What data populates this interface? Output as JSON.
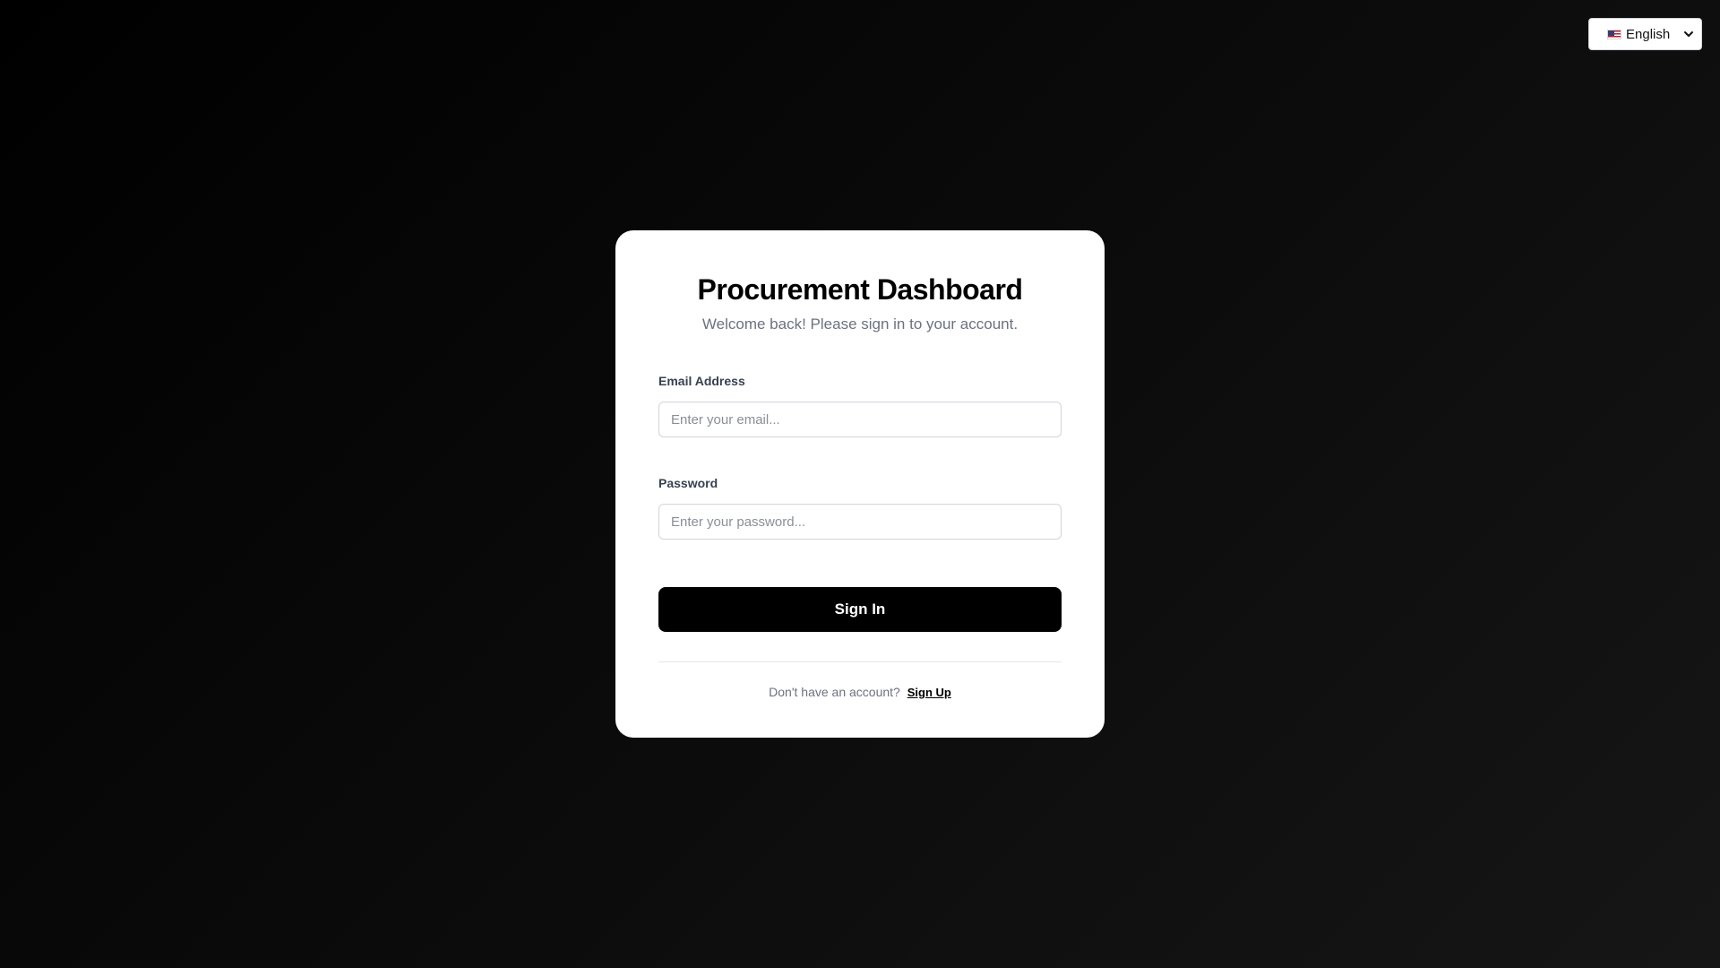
{
  "language_selector": {
    "flag_icon": "us-flag-icon",
    "selected_label": "English",
    "chevron_icon": "chevron-down-icon"
  },
  "login_card": {
    "title": "Procurement Dashboard",
    "subtitle": "Welcome back! Please sign in to your account.",
    "email_label": "Email Address",
    "email_placeholder": "Enter your email...",
    "email_value": "",
    "password_label": "Password",
    "password_placeholder": "Enter your password...",
    "password_value": "",
    "submit_label": "Sign In",
    "footer_prompt": "Don't have an account?",
    "signup_label": "Sign Up"
  },
  "colors": {
    "background": "#000000",
    "card": "#ffffff",
    "primary_button": "#000000",
    "muted_text": "#6b7280"
  }
}
